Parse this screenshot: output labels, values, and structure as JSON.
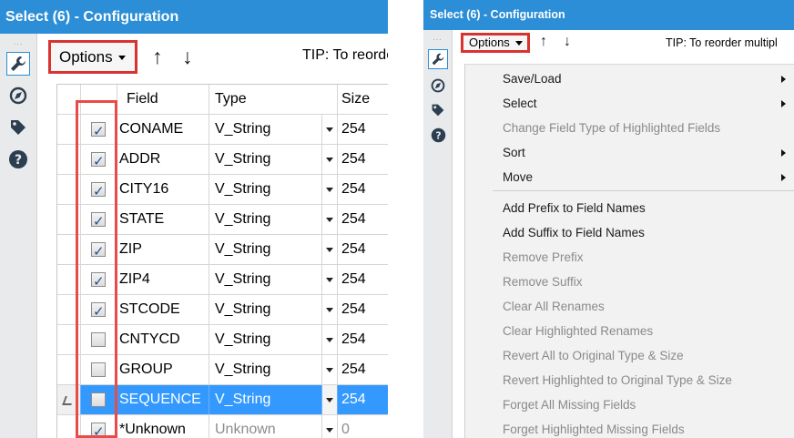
{
  "left": {
    "title": "Select (6) - Configuration",
    "grip": "...",
    "toolbar": {
      "options_label": "Options",
      "tip": "TIP: To reorde"
    },
    "columns": [
      "Field",
      "Type",
      "Size"
    ],
    "rows": [
      {
        "checked": true,
        "field": "CONAME",
        "type": "V_String",
        "size": "254",
        "selected": false
      },
      {
        "checked": true,
        "field": "ADDR",
        "type": "V_String",
        "size": "254",
        "selected": false
      },
      {
        "checked": true,
        "field": "CITY16",
        "type": "V_String",
        "size": "254",
        "selected": false
      },
      {
        "checked": true,
        "field": "STATE",
        "type": "V_String",
        "size": "254",
        "selected": false
      },
      {
        "checked": true,
        "field": "ZIP",
        "type": "V_String",
        "size": "254",
        "selected": false
      },
      {
        "checked": true,
        "field": "ZIP4",
        "type": "V_String",
        "size": "254",
        "selected": false
      },
      {
        "checked": true,
        "field": "STCODE",
        "type": "V_String",
        "size": "254",
        "selected": false
      },
      {
        "checked": false,
        "field": "CNTYCD",
        "type": "V_String",
        "size": "254",
        "selected": false
      },
      {
        "checked": false,
        "field": "GROUP",
        "type": "V_String",
        "size": "254",
        "selected": false
      },
      {
        "checked": false,
        "field": "SEQUENCE",
        "type": "V_String",
        "size": "254",
        "selected": true
      },
      {
        "checked": true,
        "field": "*Unknown",
        "type": "Unknown",
        "size": "0",
        "selected": false
      }
    ]
  },
  "right": {
    "title": "Select (6) - Configuration",
    "grip": "...",
    "toolbar": {
      "options_label": "Options",
      "tip": "TIP: To reorder multipl"
    },
    "menu": [
      {
        "label": "Save/Load",
        "enabled": true,
        "submenu": true
      },
      {
        "label": "Select",
        "enabled": true,
        "submenu": true
      },
      {
        "label": "Change Field Type of Highlighted Fields",
        "enabled": false,
        "submenu": false
      },
      {
        "label": "Sort",
        "enabled": true,
        "submenu": true
      },
      {
        "label": "Move",
        "enabled": true,
        "submenu": true
      },
      {
        "label": "Add Prefix to Field Names",
        "enabled": true,
        "submenu": false
      },
      {
        "label": "Add Suffix to Field Names",
        "enabled": true,
        "submenu": false
      },
      {
        "label": "Remove Prefix",
        "enabled": false,
        "submenu": false
      },
      {
        "label": "Remove Suffix",
        "enabled": false,
        "submenu": false
      },
      {
        "label": "Clear All Renames",
        "enabled": false,
        "submenu": false
      },
      {
        "label": "Clear Highlighted Renames",
        "enabled": false,
        "submenu": false
      },
      {
        "label": "Revert All to Original Type & Size",
        "enabled": false,
        "submenu": false
      },
      {
        "label": "Revert Highlighted to Original Type & Size",
        "enabled": false,
        "submenu": false
      },
      {
        "label": "Forget All Missing Fields",
        "enabled": false,
        "submenu": false
      },
      {
        "label": "Forget Highlighted Missing Fields",
        "enabled": false,
        "submenu": false
      }
    ]
  },
  "icons": {
    "sidebar": [
      "wrench-icon",
      "compass-icon",
      "tag-icon",
      "help-icon"
    ],
    "toolbar": [
      "move-up-icon",
      "move-down-icon"
    ],
    "arrows": {
      "up": "↑",
      "down": "↓"
    }
  },
  "colors": {
    "title_bar": "#2b8ed6",
    "selected_row": "#3399ff",
    "highlight_outline": "#d9332f"
  }
}
